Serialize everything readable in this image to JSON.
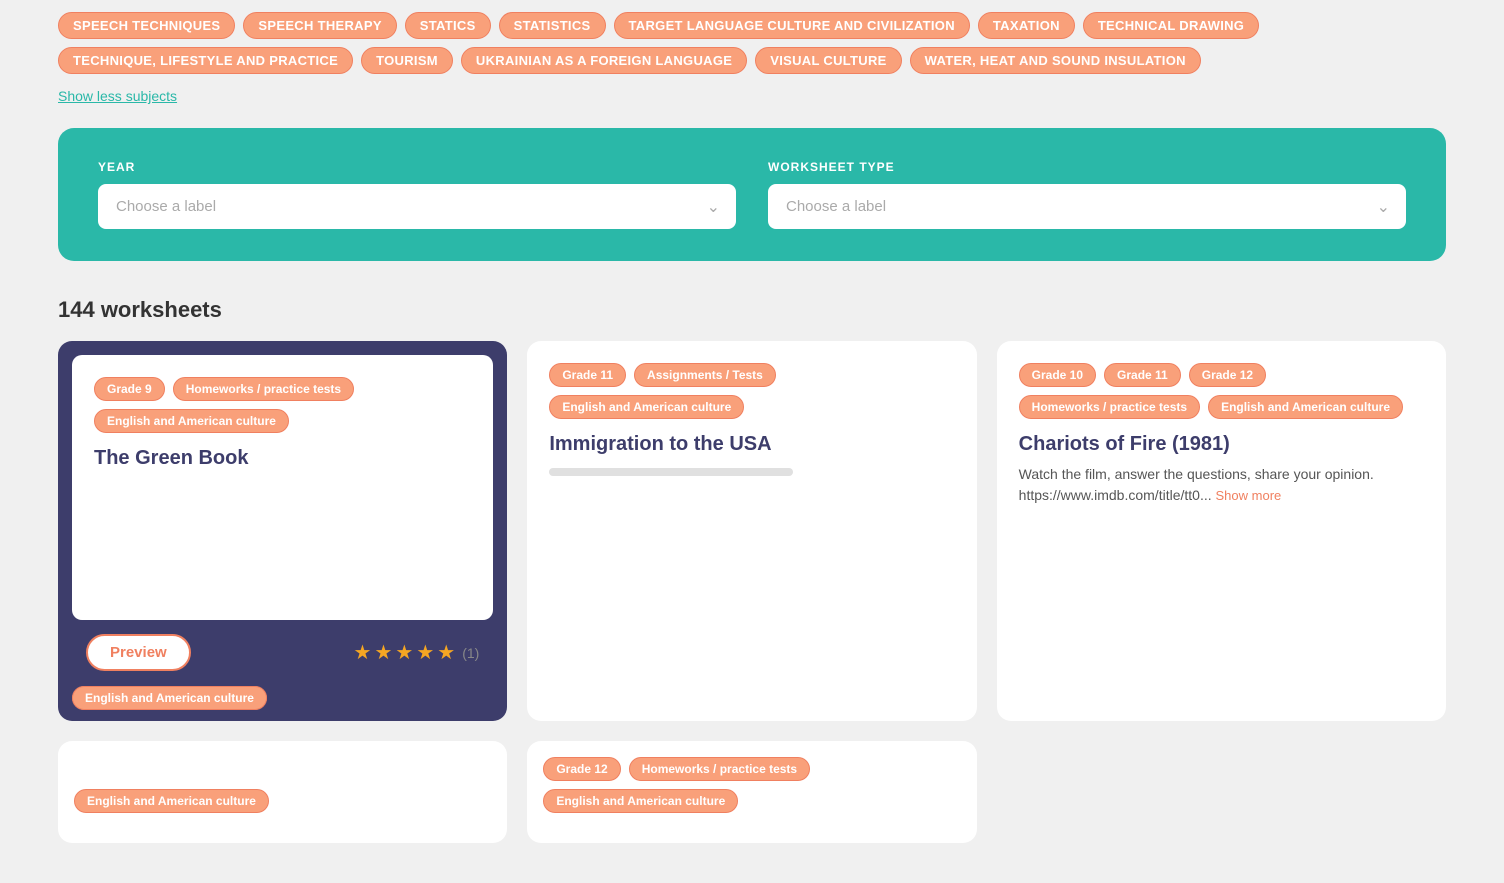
{
  "subject_tags": [
    "SPEECH TECHNIQUES",
    "SPEECH THERAPY",
    "STATICS",
    "STATISTICS",
    "TARGET LANGUAGE CULTURE AND CIVILIZATION",
    "TAXATION",
    "TECHNICAL DRAWING",
    "TECHNIQUE, LIFESTYLE AND PRACTICE",
    "TOURISM",
    "UKRAINIAN AS A FOREIGN LANGUAGE",
    "VISUAL CULTURE",
    "WATER, HEAT AND SOUND INSULATION"
  ],
  "show_less_label": "Show less subjects",
  "filter": {
    "year_label": "YEAR",
    "year_placeholder": "Choose a label",
    "worksheet_type_label": "WORKSHEET TYPE",
    "worksheet_type_placeholder": "Choose a label"
  },
  "worksheets_count": "144 worksheets",
  "cards": [
    {
      "id": "card-1",
      "featured": true,
      "tags": [
        "Grade 9",
        "Homeworks / practice tests",
        "English and American culture"
      ],
      "title": "The Green Book",
      "description": "",
      "stars": 5,
      "rating_count": "(1)",
      "preview_label": "Preview"
    },
    {
      "id": "card-2",
      "featured": false,
      "tags": [
        "Grade 11",
        "Assignments / Tests",
        "English and American culture"
      ],
      "title": "Immigration to the USA",
      "description": "",
      "stars": 0,
      "rating_count": ""
    },
    {
      "id": "card-3",
      "featured": false,
      "tags": [
        "Grade 10",
        "Grade 11",
        "Grade 12",
        "Homeworks / practice tests",
        "English and American culture"
      ],
      "title": "Chariots of Fire (1981)",
      "description": "Watch the film, answer the questions, share your opinion. https://www.imdb.com/title/tt0...",
      "show_more": "Show more",
      "stars": 0,
      "rating_count": ""
    },
    {
      "id": "card-4",
      "featured": false,
      "partial": true,
      "tags": [
        "English and American culture"
      ],
      "title": "",
      "description": ""
    },
    {
      "id": "card-5",
      "featured": false,
      "partial": true,
      "tags": [
        "Grade 12",
        "Homeworks / practice tests",
        "English and American culture"
      ],
      "title": "",
      "description": ""
    }
  ],
  "colors": {
    "teal": "#2ab8a8",
    "orange": "#f9a07a",
    "dark_blue": "#3d3d6b",
    "star_yellow": "#f5a623"
  }
}
